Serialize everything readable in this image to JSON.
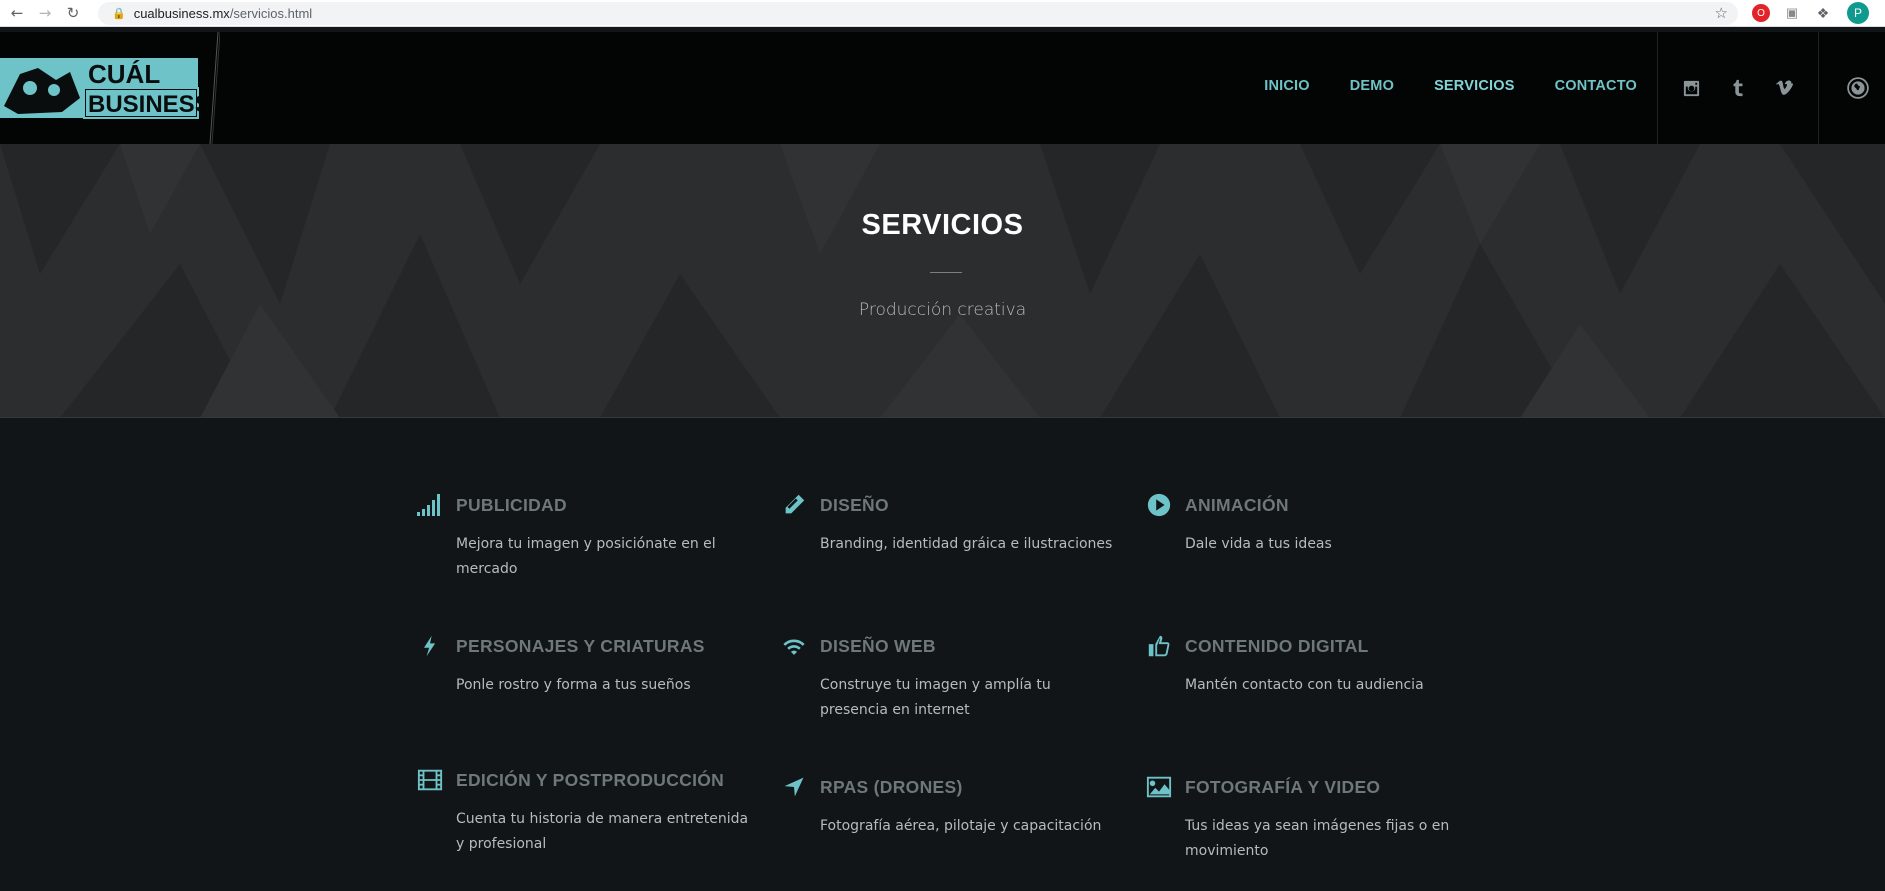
{
  "browser": {
    "url_domain": "cualbusiness.mx",
    "url_path": "/servicios.html",
    "profile_initial": "P"
  },
  "logo": {
    "line1": "CUÁL",
    "line2": "BUSINESS"
  },
  "nav": {
    "items": [
      {
        "label": "INICIO"
      },
      {
        "label": "DEMO"
      },
      {
        "label": "SERVICIOS"
      },
      {
        "label": "CONTACTO"
      }
    ],
    "active": "SERVICIOS"
  },
  "social": [
    "instagram-icon",
    "tumblr-icon",
    "vimeo-icon",
    "globe-icon"
  ],
  "hero": {
    "title": "SERVICIOS",
    "subtitle": "Producción creativa"
  },
  "services": [
    {
      "icon": "signal-bars-icon",
      "title": "PUBLICIDAD",
      "desc": "Mejora tu imagen y posiciónate en el mercado"
    },
    {
      "icon": "pencil-icon",
      "title": "DISEÑO",
      "desc": "Branding, identidad gráica e ilustraciones"
    },
    {
      "icon": "play-circle-icon",
      "title": "ANIMACIÓN",
      "desc": "Dale vida a tus ideas"
    },
    {
      "icon": "lightning-icon",
      "title": "PERSONAJES Y CRIATURAS",
      "desc": "Ponle rostro y forma a tus sueños"
    },
    {
      "icon": "wifi-icon",
      "title": "DISEÑO WEB",
      "desc": "Construye tu imagen y amplía tu presencia en internet"
    },
    {
      "icon": "thumbs-up-icon",
      "title": "CONTENIDO DIGITAL",
      "desc": "Mantén contacto con tu audiencia"
    },
    {
      "icon": "film-icon",
      "title": "EDICIÓN Y POSTPRODUCCIÓN",
      "desc": "Cuenta tu historia de manera entretenida y profesional"
    },
    {
      "icon": "location-arrow-icon",
      "title": "RPAS (DRONES)",
      "desc": "Fotografía aérea, pilotaje y capacitación"
    },
    {
      "icon": "picture-icon",
      "title": "FOTOGRAFÍA Y VIDEO",
      "desc": "Tus ideas ya sean imágenes fijas o en movimiento"
    }
  ],
  "colors": {
    "accent": "#6dc3c7",
    "header_bg": "#030404",
    "hero_bg": "#2b2d2e",
    "section_bg": "#111517"
  }
}
